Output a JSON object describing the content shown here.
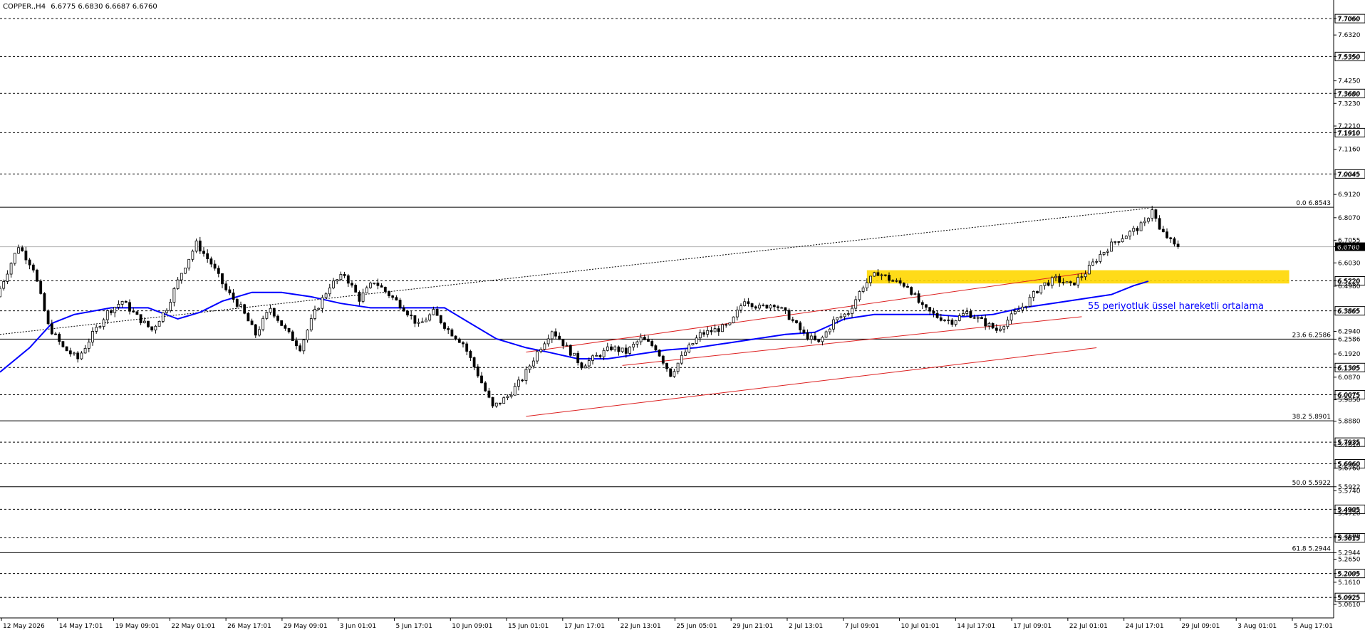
{
  "header": {
    "symbol_label": "COPPER.,H4",
    "ohlc_label": "6.6775 6.6830 6.6687 6.6760"
  },
  "chart_data": {
    "type": "candlestick",
    "symbol": "COPPER.",
    "timeframe": "H4",
    "ohlc": {
      "open": 6.6775,
      "high": 6.683,
      "low": 6.6687,
      "close": 6.676
    },
    "ylim": [
      5.0,
      7.79
    ],
    "y_ticks": [
      "7.7060",
      "7.6320",
      "7.5350",
      "7.4250",
      "7.3680",
      "7.3230",
      "7.2210",
      "7.1910",
      "7.1160",
      "7.0045",
      "6.9120",
      "6.8070",
      "6.7055",
      "6.6760",
      "6.6030",
      "6.5220",
      "6.4980",
      "6.3865",
      "6.2940",
      "6.2586",
      "6.1920",
      "6.1305",
      "6.0870",
      "6.0075",
      "5.9850",
      "5.8880",
      "5.7935",
      "5.7810",
      "5.6960",
      "5.6760",
      "5.5922",
      "5.5740",
      "5.4905",
      "5.4720",
      "5.3615",
      "5.3690",
      "5.2944",
      "5.2650",
      "5.2005",
      "5.1610",
      "5.0925",
      "5.0610"
    ],
    "x_ticks": [
      "12 May 2026",
      "14 May 17:01",
      "19 May 09:01",
      "22 May 01:01",
      "26 May 17:01",
      "29 May 09:01",
      "3 Jun 01:01",
      "5 Jun 17:01",
      "10 Jun 09:01",
      "15 Jun 01:01",
      "17 Jun 17:01",
      "22 Jun 13:01",
      "25 Jun 05:01",
      "29 Jun 21:01",
      "2 Jul 13:01",
      "7 Jul 09:01",
      "10 Jul 01:01",
      "14 Jul 17:01",
      "17 Jul 09:01",
      "22 Jul 01:01",
      "24 Jul 17:01",
      "29 Jul 09:01",
      "3 Aug 01:01",
      "5 Aug 17:01"
    ],
    "current_price": "6.6760",
    "levels": [
      {
        "price": 7.706,
        "label": "7.7060",
        "style": "dash"
      },
      {
        "price": 7.535,
        "label": "7.5350",
        "style": "dash"
      },
      {
        "price": 7.368,
        "label": "7.3680",
        "style": "dash"
      },
      {
        "price": 7.191,
        "label": "7.1910",
        "style": "dash"
      },
      {
        "price": 7.0045,
        "label": "7.0045",
        "style": "dash"
      },
      {
        "price": 6.522,
        "label": "6.5220",
        "style": "dash"
      },
      {
        "price": 6.3865,
        "label": "6.3865",
        "style": "dash"
      },
      {
        "price": 6.1305,
        "label": "6.1305",
        "style": "dash"
      },
      {
        "price": 6.0075,
        "label": "6.0075",
        "style": "dash"
      },
      {
        "price": 5.7935,
        "label": "5.7935",
        "style": "dash"
      },
      {
        "price": 5.696,
        "label": "5.6960",
        "style": "dash"
      },
      {
        "price": 5.4905,
        "label": "5.4905",
        "style": "dash"
      },
      {
        "price": 5.3615,
        "label": "5.3615",
        "style": "dash"
      },
      {
        "price": 5.2005,
        "label": "5.2005",
        "style": "dash"
      },
      {
        "price": 5.0925,
        "label": "5.0925",
        "style": "dash"
      }
    ],
    "fibonacci": [
      {
        "label": "0.0 6.8543",
        "price": 6.8543
      },
      {
        "label": "23.6 6.2586",
        "price": 6.2586
      },
      {
        "label": "38.2 5.8901",
        "price": 5.8901
      },
      {
        "label": "50.0 5.5922",
        "price": 5.5922
      },
      {
        "label": "61.8 5.2944",
        "price": 5.2944
      }
    ],
    "ema_label": "55 periyotluk üssel hareketli ortalama",
    "ema_period": 55,
    "price_path": [
      [
        0,
        6.45
      ],
      [
        3,
        6.68
      ],
      [
        5,
        6.58
      ],
      [
        7,
        6.32
      ],
      [
        9,
        6.22
      ],
      [
        11,
        6.17
      ],
      [
        13,
        6.28
      ],
      [
        15,
        6.38
      ],
      [
        17,
        6.43
      ],
      [
        19,
        6.36
      ],
      [
        21,
        6.3
      ],
      [
        23,
        6.4
      ],
      [
        25,
        6.56
      ],
      [
        27,
        6.69
      ],
      [
        29,
        6.6
      ],
      [
        31,
        6.48
      ],
      [
        33,
        6.4
      ],
      [
        35,
        6.28
      ],
      [
        37,
        6.4
      ],
      [
        39,
        6.3
      ],
      [
        41,
        6.22
      ],
      [
        43,
        6.38
      ],
      [
        45,
        6.5
      ],
      [
        47,
        6.55
      ],
      [
        49,
        6.44
      ],
      [
        51,
        6.52
      ],
      [
        53,
        6.46
      ],
      [
        55,
        6.4
      ],
      [
        57,
        6.32
      ],
      [
        59,
        6.38
      ],
      [
        61,
        6.3
      ],
      [
        63,
        6.24
      ],
      [
        65,
        6.1
      ],
      [
        67,
        5.95
      ],
      [
        69,
        6.0
      ],
      [
        71,
        6.08
      ],
      [
        73,
        6.2
      ],
      [
        75,
        6.3
      ],
      [
        77,
        6.22
      ],
      [
        79,
        6.14
      ],
      [
        81,
        6.18
      ],
      [
        83,
        6.22
      ],
      [
        85,
        6.2
      ],
      [
        87,
        6.26
      ],
      [
        89,
        6.22
      ],
      [
        91,
        6.1
      ],
      [
        93,
        6.2
      ],
      [
        95,
        6.28
      ],
      [
        97,
        6.3
      ],
      [
        99,
        6.32
      ],
      [
        101,
        6.44
      ],
      [
        103,
        6.4
      ],
      [
        105,
        6.42
      ],
      [
        107,
        6.36
      ],
      [
        109,
        6.28
      ],
      [
        111,
        6.24
      ],
      [
        113,
        6.34
      ],
      [
        115,
        6.38
      ],
      [
        117,
        6.5
      ],
      [
        119,
        6.56
      ],
      [
        121,
        6.52
      ],
      [
        123,
        6.5
      ],
      [
        125,
        6.4
      ],
      [
        127,
        6.36
      ],
      [
        129,
        6.34
      ],
      [
        131,
        6.38
      ],
      [
        133,
        6.34
      ],
      [
        135,
        6.3
      ],
      [
        137,
        6.36
      ],
      [
        139,
        6.42
      ],
      [
        141,
        6.5
      ],
      [
        143,
        6.53
      ],
      [
        145,
        6.5
      ],
      [
        147,
        6.56
      ],
      [
        149,
        6.64
      ],
      [
        151,
        6.7
      ],
      [
        153,
        6.74
      ],
      [
        155,
        6.78
      ],
      [
        156,
        6.85
      ],
      [
        157,
        6.75
      ],
      [
        158,
        6.72
      ],
      [
        159,
        6.68
      ]
    ],
    "ema_path": [
      [
        0,
        6.11
      ],
      [
        4,
        6.22
      ],
      [
        7,
        6.33
      ],
      [
        10,
        6.37
      ],
      [
        15,
        6.4
      ],
      [
        20,
        6.4
      ],
      [
        24,
        6.35
      ],
      [
        27,
        6.38
      ],
      [
        30,
        6.43
      ],
      [
        34,
        6.47
      ],
      [
        38,
        6.47
      ],
      [
        42,
        6.45
      ],
      [
        46,
        6.42
      ],
      [
        50,
        6.4
      ],
      [
        56,
        6.4
      ],
      [
        60,
        6.4
      ],
      [
        63,
        6.34
      ],
      [
        67,
        6.26
      ],
      [
        71,
        6.22
      ],
      [
        74,
        6.2
      ],
      [
        78,
        6.17
      ],
      [
        82,
        6.17
      ],
      [
        86,
        6.19
      ],
      [
        90,
        6.21
      ],
      [
        94,
        6.22
      ],
      [
        98,
        6.24
      ],
      [
        102,
        6.26
      ],
      [
        106,
        6.28
      ],
      [
        110,
        6.29
      ],
      [
        114,
        6.35
      ],
      [
        118,
        6.37
      ],
      [
        122,
        6.37
      ],
      [
        126,
        6.37
      ],
      [
        130,
        6.36
      ],
      [
        134,
        6.37
      ],
      [
        138,
        6.4
      ],
      [
        142,
        6.42
      ],
      [
        146,
        6.44
      ],
      [
        150,
        6.46
      ],
      [
        153,
        6.5
      ],
      [
        155,
        6.52
      ]
    ],
    "channel": {
      "upper": [
        [
          71,
          6.2
        ],
        [
          147,
          6.56
        ]
      ],
      "middle": [
        [
          84,
          6.14
        ],
        [
          146,
          6.36
        ]
      ],
      "lower": [
        [
          71,
          5.91
        ],
        [
          148,
          6.22
        ]
      ]
    },
    "trendline": [
      [
        0,
        6.28
      ],
      [
        155,
        6.85
      ]
    ],
    "zone": {
      "x": [
        117,
        174
      ],
      "y_top": 6.57,
      "y_bottom": 6.51,
      "color": "#FFD700"
    },
    "colors": {
      "candle": "#000000",
      "ema": "#0000FF",
      "channel": "#DC2020",
      "zone": "#FFD700",
      "price_label_bg": "#000000",
      "ema_text": "#0000FF"
    }
  }
}
